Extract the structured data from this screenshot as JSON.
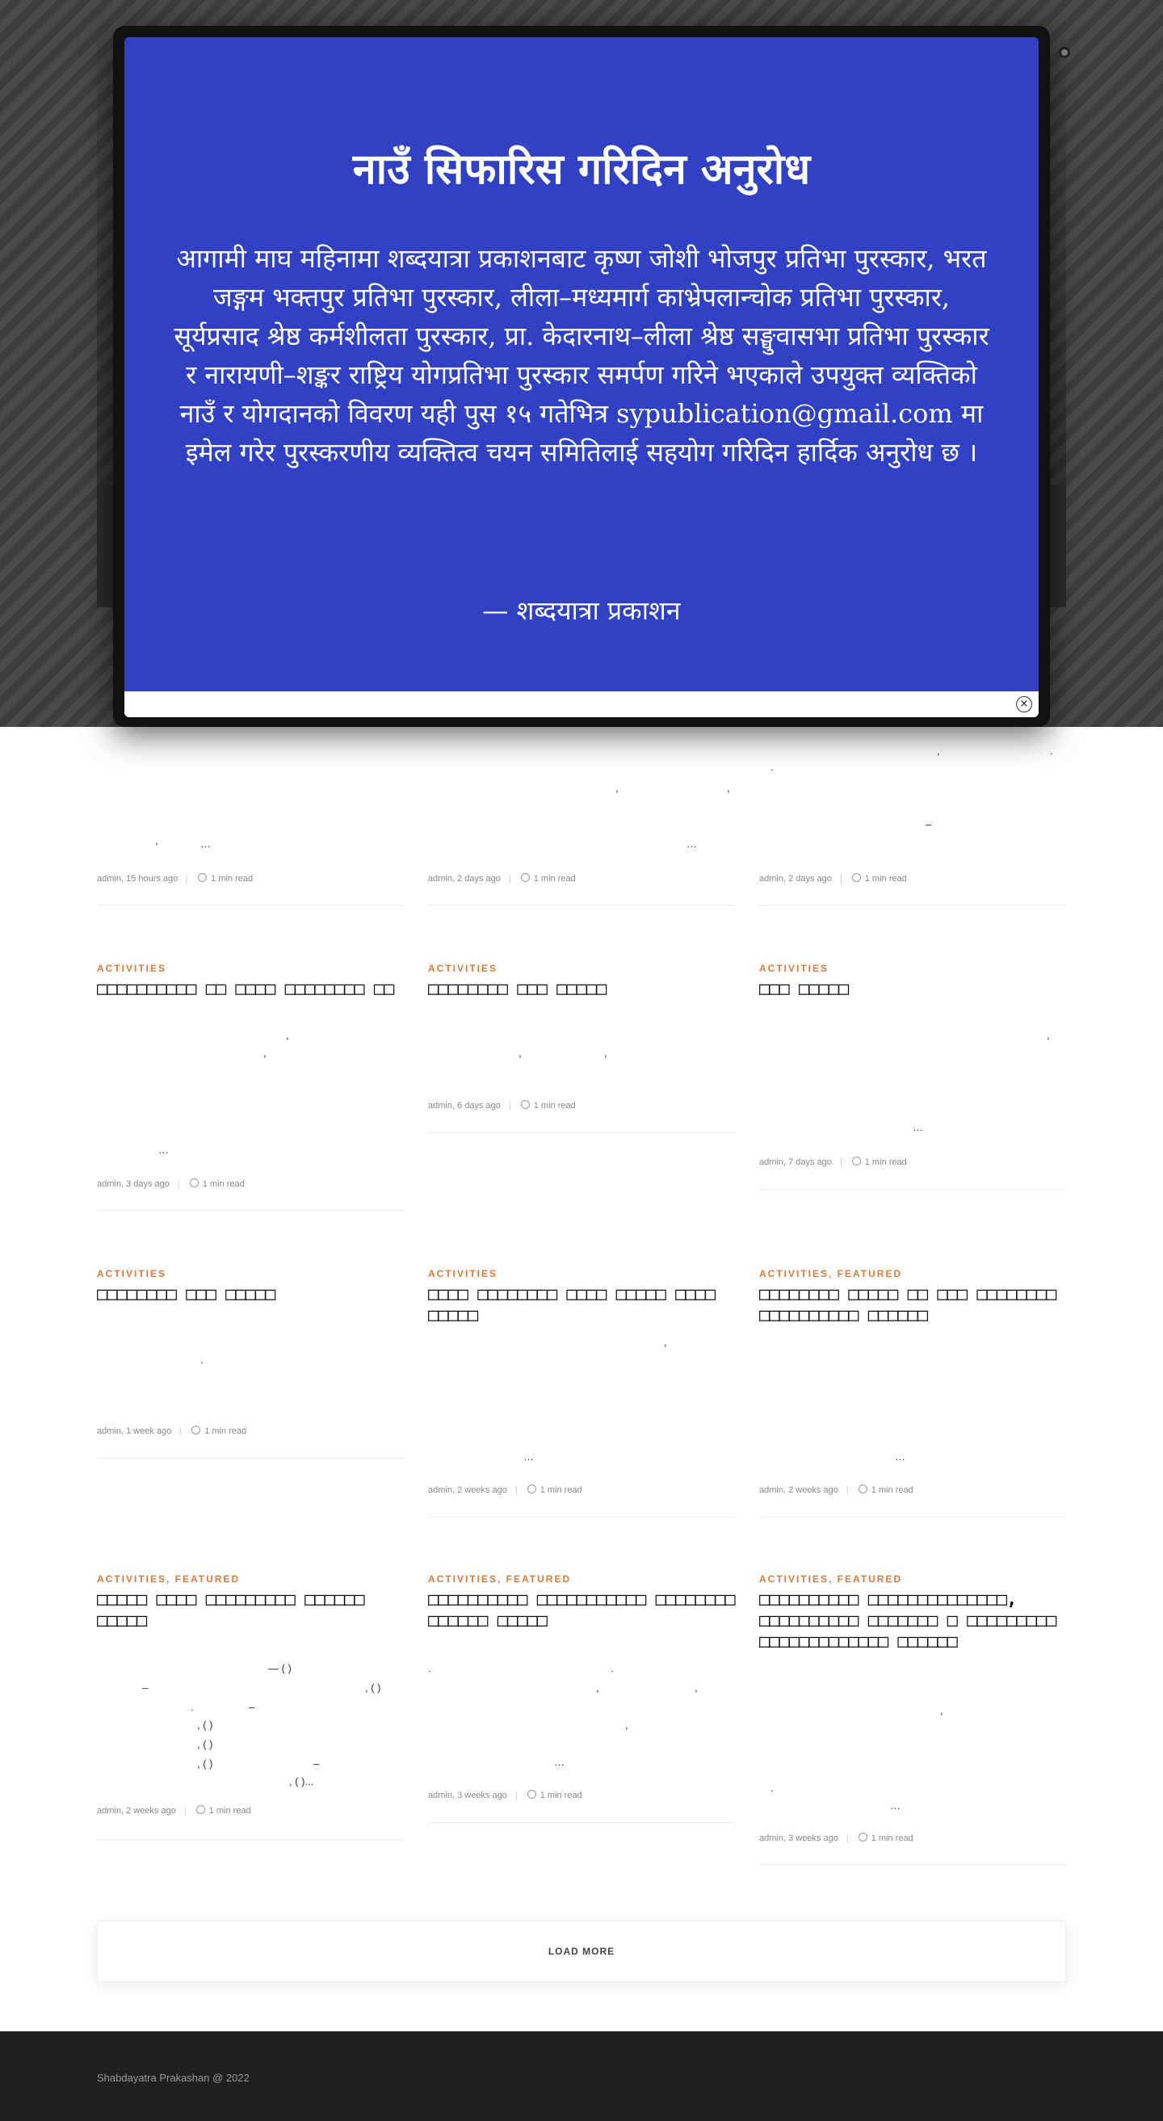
{
  "modal": {
    "title": "नाउँ सिफारिस गरिदिन अनुरोध",
    "body": "आगामी माघ महिनामा शब्दयात्रा प्रकाशनबाट कृष्ण जोशी भोजपुर प्रतिभा पुरस्कार, भरत जङ्गम भक्तपुर प्रतिभा पुरस्कार, लीला–मध्यमार्ग काभ्रेपलान्चोक प्रतिभा पुरस्कार, सूर्यप्रसाद श्रेष्ठ कर्मशीलता पुरस्कार, प्रा. केदारनाथ–लीला श्रेष्ठ सङ्घुवासभा प्रतिभा पुरस्कार र नारायणी–शङ्कर राष्ट्रिय योगप्रतिभा पुरस्कार समर्पण गरिने भएकाले उपयुक्त व्यक्तिको नाउँ र योगदानको विवरण यही पुस १५ गतेभित्र sypublication@gmail.com मा इमेल गरेर पुरस्करणीय व्यक्तित्व चयन समितिलाई सहयोग गरिदिन हार्दिक अनुरोध छ ।",
    "signature": "— शब्दयात्रा प्रकाशन",
    "close": "×"
  },
  "posts": [
    {
      "meta_author": "admin, 15 hours ago",
      "read": "1 min read"
    },
    {
      "meta_author": "admin, 2 days ago",
      "read": "1 min read"
    },
    {
      "meta_author": "admin, 2 days ago",
      "read": "1 min read"
    },
    {
      "category": "ACTIVITIES",
      "title": "□□□□□□□□□□ □□ □□□□ □□□□□□□□ □□",
      "meta_author": "admin, 3 days ago",
      "read": "1 min read"
    },
    {
      "category": "ACTIVITIES",
      "title": "□□□□□□□□ □□□ □□□□□",
      "meta_author": "admin, 6 days ago",
      "read": "1 min read"
    },
    {
      "category": "ACTIVITIES",
      "title": "□□□ □□□□□",
      "meta_author": "admin, 7 days ago",
      "read": "1 min read"
    },
    {
      "category": "ACTIVITIES",
      "title": "□□□□□□□□ □□□ □□□□□",
      "meta_author": "admin, 1 week ago",
      "read": "1 min read"
    },
    {
      "category": "ACTIVITIES",
      "title": "□□□□ □□□□□□□□ □□□□ □□□□□ □□□□ □□□□□",
      "meta_author": "admin, 2 weeks ago",
      "read": "1 min read"
    },
    {
      "category": "ACTIVITIES, FEATURED",
      "title": "□□□□□□□□ □□□□□ □□ □□□ □□□□□□□□ □□□□□□□□□□ □□□□□□",
      "meta_author": "admin, 2 weeks ago",
      "read": "1 min read"
    },
    {
      "category": "ACTIVITIES, FEATURED",
      "title": "□□□□□ □□□□ □□□□□□□□□ □□□□□□ □□□□□",
      "meta_author": "admin, 2 weeks ago",
      "read": "1 min read"
    },
    {
      "category": "ACTIVITIES, FEATURED",
      "title": "□□□□□□□□□□ □□□□□□□□□□□ □□□□□□□□ □□□□□□ □□□□□",
      "meta_author": "admin, 3 weeks ago",
      "read": "1 min read"
    },
    {
      "category": "ACTIVITIES, FEATURED",
      "title": "□□□□□□□□□□ □□□□□□□□□□□□□□, □□□□□□□□□□ □□□□□□□ □ □□□□□□□□□ □□□□□□□□□□□□□ □□□□□□",
      "meta_author": "admin, 3 weeks ago",
      "read": "1 min read"
    }
  ],
  "fragments": {
    "comma": ",",
    "dot": ".",
    "ellipsis": "…",
    "dash": "–",
    "paren": "— ( )",
    "paren2": ", ( )",
    "paren3": ", ( )..."
  },
  "load_more": "LOAD MORE",
  "footer": {
    "copyright": "Shabdayatra Prakashan @ 2022"
  }
}
